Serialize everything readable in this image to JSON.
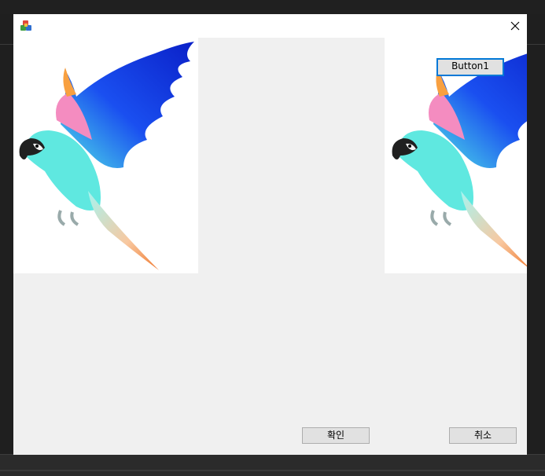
{
  "window": {
    "icon": "app-icon",
    "close_icon": "close-icon"
  },
  "images": {
    "left": "parrot-image",
    "right": "parrot-image"
  },
  "buttons": {
    "button1_label": "Button1",
    "ok_label": "확인",
    "cancel_label": "취소"
  },
  "colors": {
    "dialog_bg": "#f0f0f0",
    "focus_border": "#0078d7"
  }
}
